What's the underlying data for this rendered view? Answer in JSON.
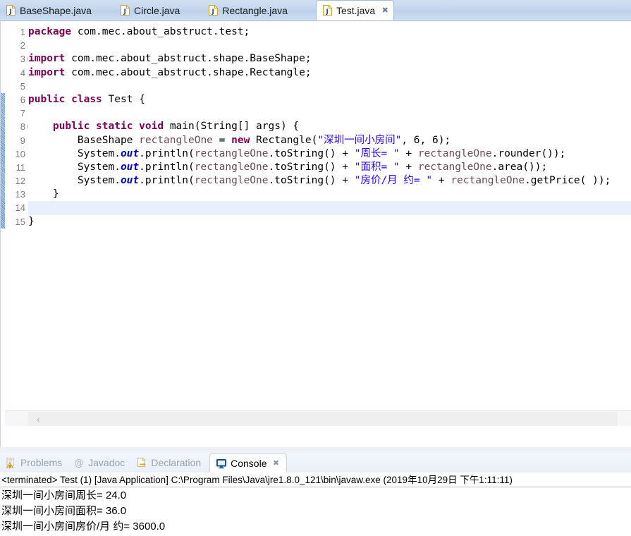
{
  "editor_tabs": [
    {
      "label": "BaseShape.java",
      "icon": "java-file-icon",
      "active": false,
      "closable": false
    },
    {
      "label": "Circle.java",
      "icon": "java-file-icon",
      "active": false,
      "closable": false
    },
    {
      "label": "Rectangle.java",
      "icon": "java-file-icon",
      "active": false,
      "closable": false
    },
    {
      "label": "Test.java",
      "icon": "java-file-icon",
      "active": true,
      "closable": true,
      "close_glyph": "✖"
    }
  ],
  "editor": {
    "current_line": 14,
    "lines": [
      {
        "n": "1",
        "fold": false,
        "changed": false
      },
      {
        "n": "2",
        "fold": false,
        "changed": false
      },
      {
        "n": "3",
        "fold": true,
        "changed": false
      },
      {
        "n": "4",
        "fold": false,
        "changed": false
      },
      {
        "n": "5",
        "fold": false,
        "changed": false
      },
      {
        "n": "6",
        "fold": false,
        "changed": true
      },
      {
        "n": "7",
        "fold": false,
        "changed": true
      },
      {
        "n": "8",
        "fold": true,
        "changed": true
      },
      {
        "n": "9",
        "fold": false,
        "changed": true
      },
      {
        "n": "10",
        "fold": false,
        "changed": true
      },
      {
        "n": "11",
        "fold": false,
        "changed": true
      },
      {
        "n": "12",
        "fold": false,
        "changed": true
      },
      {
        "n": "13",
        "fold": false,
        "changed": true
      },
      {
        "n": "14",
        "fold": false,
        "changed": true
      },
      {
        "n": "15",
        "fold": false,
        "changed": true
      }
    ],
    "code": [
      [
        {
          "t": "package",
          "c": "kw"
        },
        {
          "t": " com.mec.about_abstruct.test;",
          "c": "plain"
        }
      ],
      [],
      [
        {
          "t": "import",
          "c": "kw"
        },
        {
          "t": " com.mec.about_abstruct.shape.BaseShape;",
          "c": "plain"
        }
      ],
      [
        {
          "t": "import",
          "c": "kw"
        },
        {
          "t": " com.mec.about_abstruct.shape.Rectangle;",
          "c": "plain"
        }
      ],
      [],
      [
        {
          "t": "public",
          "c": "kw"
        },
        {
          "t": " ",
          "c": "plain"
        },
        {
          "t": "class",
          "c": "kw"
        },
        {
          "t": " Test {",
          "c": "plain"
        }
      ],
      [],
      [
        {
          "t": "    ",
          "c": "plain"
        },
        {
          "t": "public",
          "c": "kw"
        },
        {
          "t": " ",
          "c": "plain"
        },
        {
          "t": "static",
          "c": "kw"
        },
        {
          "t": " ",
          "c": "plain"
        },
        {
          "t": "void",
          "c": "kw"
        },
        {
          "t": " main(String[] args) {",
          "c": "plain"
        }
      ],
      [
        {
          "t": "        BaseShape ",
          "c": "plain"
        },
        {
          "t": "rectangleOne",
          "c": "var"
        },
        {
          "t": " = ",
          "c": "plain"
        },
        {
          "t": "new",
          "c": "kw"
        },
        {
          "t": " Rectangle(",
          "c": "plain"
        },
        {
          "t": "\"深圳一间小房间\"",
          "c": "str"
        },
        {
          "t": ", 6, 6);",
          "c": "plain"
        }
      ],
      [
        {
          "t": "        System.",
          "c": "plain"
        },
        {
          "t": "out",
          "c": "fld"
        },
        {
          "t": ".println(",
          "c": "plain"
        },
        {
          "t": "rectangleOne",
          "c": "var"
        },
        {
          "t": ".toString() + ",
          "c": "plain"
        },
        {
          "t": "\"周长= \"",
          "c": "str"
        },
        {
          "t": " + ",
          "c": "plain"
        },
        {
          "t": "rectangleOne",
          "c": "var"
        },
        {
          "t": ".rounder());",
          "c": "plain"
        }
      ],
      [
        {
          "t": "        System.",
          "c": "plain"
        },
        {
          "t": "out",
          "c": "fld"
        },
        {
          "t": ".println(",
          "c": "plain"
        },
        {
          "t": "rectangleOne",
          "c": "var"
        },
        {
          "t": ".toString() + ",
          "c": "plain"
        },
        {
          "t": "\"面积= \"",
          "c": "str"
        },
        {
          "t": " + ",
          "c": "plain"
        },
        {
          "t": "rectangleOne",
          "c": "var"
        },
        {
          "t": ".area());",
          "c": "plain"
        }
      ],
      [
        {
          "t": "        System.",
          "c": "plain"
        },
        {
          "t": "out",
          "c": "fld"
        },
        {
          "t": ".println(",
          "c": "plain"
        },
        {
          "t": "rectangleOne",
          "c": "var"
        },
        {
          "t": ".toString() + ",
          "c": "plain"
        },
        {
          "t": "\"房价/月 约= \"",
          "c": "str"
        },
        {
          "t": " + ",
          "c": "plain"
        },
        {
          "t": "rectangleOne",
          "c": "var"
        },
        {
          "t": ".getPrice( ));",
          "c": "plain"
        }
      ],
      [
        {
          "t": "    }",
          "c": "plain"
        }
      ],
      [],
      [
        {
          "t": "}",
          "c": "plain"
        }
      ]
    ],
    "scroll_left_arrow": "‹"
  },
  "view_tabs": [
    {
      "label": "Problems",
      "icon": "problems-icon",
      "active": false,
      "closable": false
    },
    {
      "label": "Javadoc",
      "icon": "javadoc-icon",
      "active": false,
      "closable": false
    },
    {
      "label": "Declaration",
      "icon": "declaration-icon",
      "active": false,
      "closable": false
    },
    {
      "label": "Console",
      "icon": "console-icon",
      "active": true,
      "closable": true,
      "close_glyph": "✖"
    }
  ],
  "console": {
    "header": "<terminated> Test (1) [Java Application] C:\\Program Files\\Java\\jre1.8.0_121\\bin\\javaw.exe (2019年10月29日 下午1:11:11)",
    "output": [
      "深圳一间小房间周长= 24.0",
      "深圳一间小房间面积= 36.0",
      "深圳一间小房间房价/月 约= 3600.0"
    ]
  },
  "colors": {
    "keyword": "#7f0055",
    "string": "#2a00ff",
    "static_field": "#0000c0",
    "local_var": "#6a4a52",
    "tab_bar": "#c3d6ee",
    "current_line": "#e8f0fe",
    "change_bar": "#7aa5d8"
  }
}
